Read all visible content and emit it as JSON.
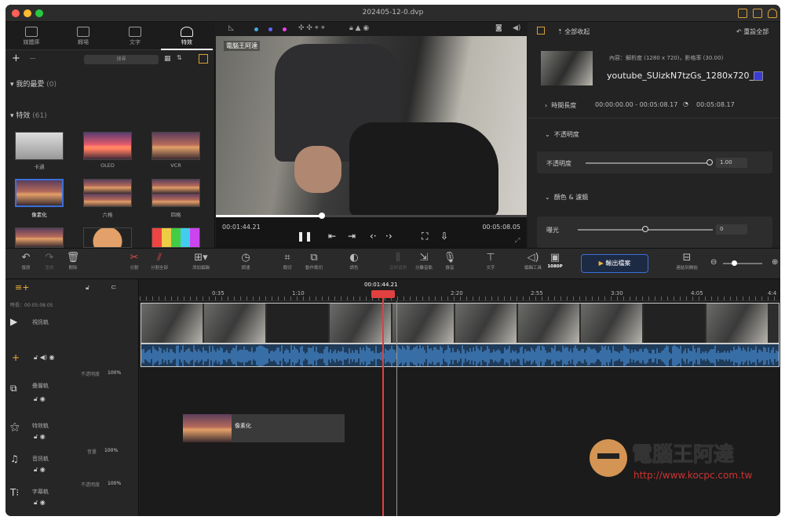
{
  "window": {
    "title": "202405-12-0.dvp"
  },
  "tabs": [
    {
      "label": "媒體庫",
      "icon": "media-icon"
    },
    {
      "label": "轉場",
      "icon": "transition-icon"
    },
    {
      "label": "文字",
      "icon": "text-icon"
    },
    {
      "label": "特效",
      "icon": "effects-icon",
      "active": true
    }
  ],
  "library": {
    "search_placeholder": "搜尋",
    "favorites": {
      "label": "我的最愛",
      "count": "(0)"
    },
    "effects": {
      "label": "特效",
      "count": "(61)"
    },
    "thumbs": [
      "卡通",
      "OLED",
      "VCR",
      "像素化",
      "六格",
      "四格"
    ]
  },
  "preview": {
    "watermark": "電腦王阿達",
    "current_time": "00:01:44.21",
    "total_time": "00:05:08.05",
    "progress": 0.34
  },
  "inspector": {
    "collapse_all": "全部收起",
    "reset_all": "重設全部",
    "content_info": "內容：解析度 (1280 x 720)，影格率 (30.00)",
    "filename": "youtube_SUizkN7tzGs_1280x720_",
    "duration_label": "時間長度",
    "duration_value": "00:00:00.00 - 00:05:08.17",
    "duration_total": "00:05:08.17",
    "opacity_section": "不透明度",
    "opacity_label": "不透明度",
    "opacity_value": "1.00",
    "color_section": "顏色 & 濾鏡",
    "exposure_label": "曝光",
    "exposure_value": "0"
  },
  "toolbar": {
    "undo": "復原",
    "redo": "重做",
    "delete": "刪除",
    "split": "分割",
    "split_all": "分割全部",
    "add_edit": "添加編輯",
    "speed": "調速",
    "crop": "裁切",
    "motion_crop": "動作裁切",
    "color": "調色",
    "audio_detect": "音訊偵測",
    "split_audio": "分離音軌",
    "record": "錄音",
    "text": "文字",
    "tools": "編輯工具",
    "resolution": "1080P",
    "export": "輸出檔案",
    "to_start": "連結到開始"
  },
  "timeline": {
    "playhead_time": "00:01:44.21",
    "head_time": "時長：00:05:08.05",
    "ruler": [
      "0:35",
      "1:10",
      "2:20",
      "2:55",
      "3:30",
      "4:05",
      "4:4"
    ],
    "tracks": [
      {
        "name": "視訊軌",
        "icon": "video-track-icon"
      },
      {
        "name": "疊層軌",
        "icon": "overlay-track-icon",
        "opacity_label": "不透明度",
        "opacity": "100%"
      },
      {
        "name": "特效軌",
        "icon": "fx-track-icon"
      },
      {
        "name": "音訊軌",
        "icon": "music-track-icon",
        "volume_label": "音量",
        "volume": "100%"
      },
      {
        "name": "字幕軌",
        "icon": "subtitle-track-icon",
        "opacity_label": "不透明度",
        "opacity": "100%"
      }
    ],
    "fx_clip": "像素化"
  },
  "branding": {
    "text": "電腦王阿達",
    "url": "http://www.kocpc.com.tw"
  },
  "colors": {
    "accent_blue": "#3b6fd8",
    "playhead": "#e04040",
    "audio": "#4a90d9"
  }
}
